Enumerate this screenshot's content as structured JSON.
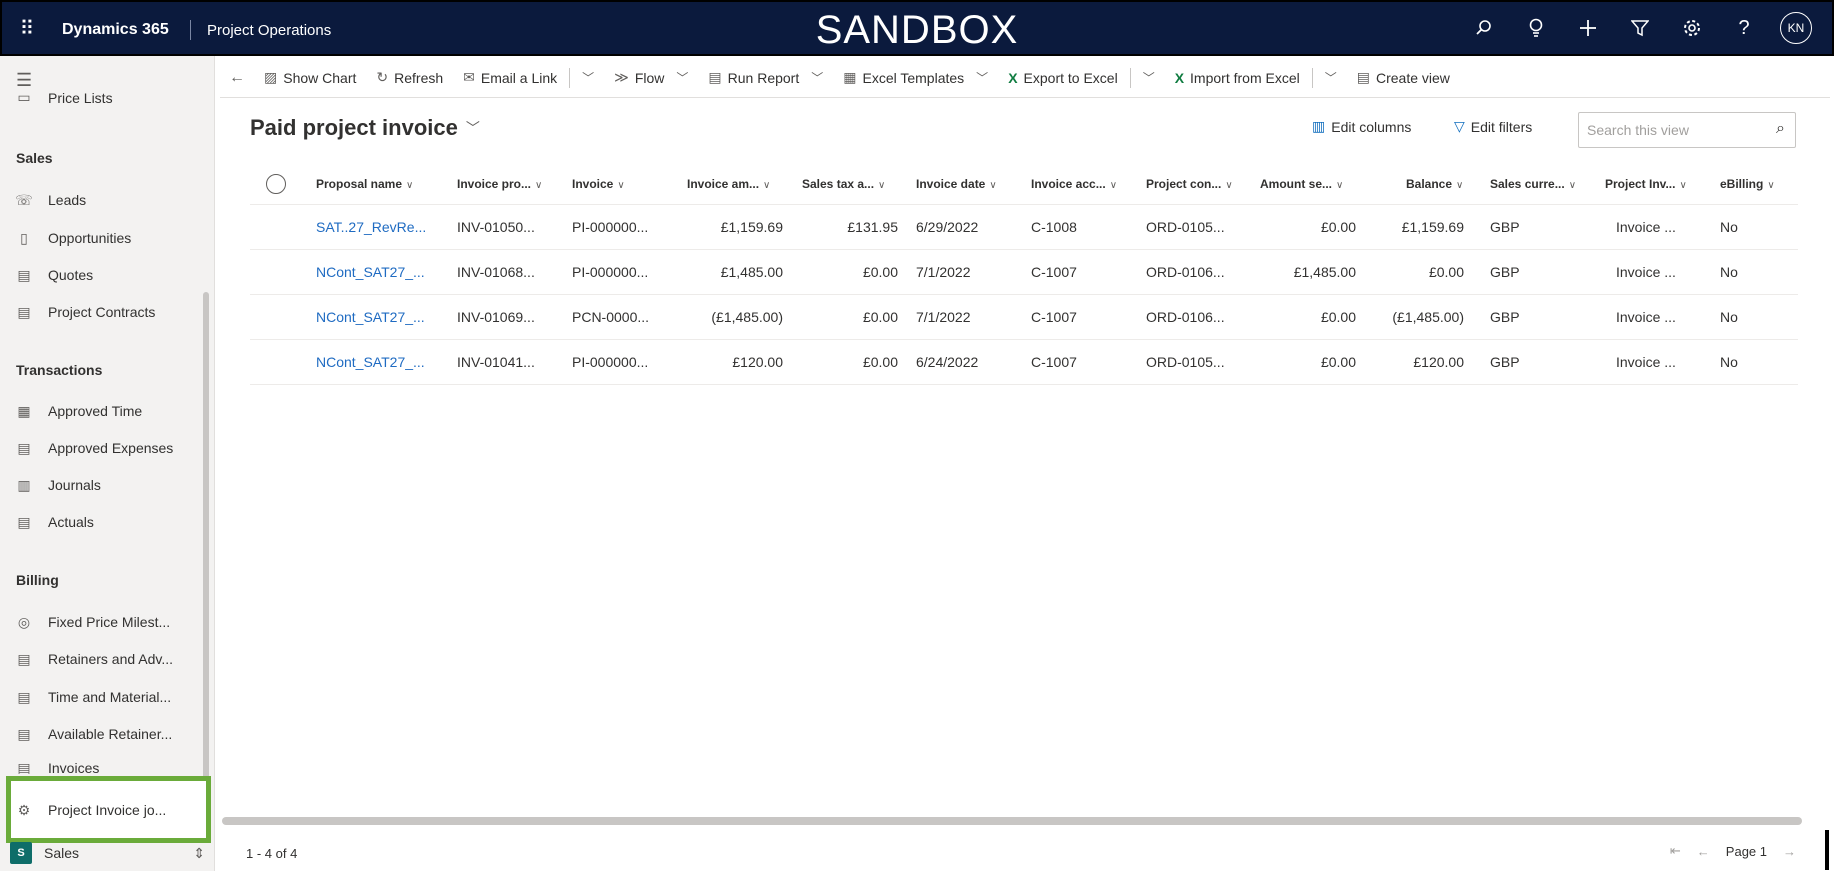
{
  "topbar": {
    "app_name": "Dynamics 365",
    "area_name": "Project Operations",
    "environment_banner": "SANDBOX",
    "user_initials": "KN"
  },
  "sidebar": {
    "partial_item": "Price Lists",
    "sections": [
      {
        "title": "Sales",
        "items": [
          "Leads",
          "Opportunities",
          "Quotes",
          "Project Contracts"
        ]
      },
      {
        "title": "Transactions",
        "items": [
          "Approved Time",
          "Approved Expenses",
          "Journals",
          "Actuals"
        ]
      },
      {
        "title": "Billing",
        "items": [
          "Fixed Price Milest...",
          "Retainers and Adv...",
          "Time and Material...",
          "Available Retainer...",
          "Invoices",
          "Project Invoice jo..."
        ]
      }
    ],
    "area_switcher": {
      "badge": "S",
      "label": "Sales"
    }
  },
  "commandbar": {
    "show_chart": "Show Chart",
    "refresh": "Refresh",
    "email_link": "Email a Link",
    "flow": "Flow",
    "run_report": "Run Report",
    "excel_templates": "Excel Templates",
    "export_excel": "Export to Excel",
    "import_excel": "Import from Excel",
    "create_view": "Create view"
  },
  "view": {
    "title": "Paid project invoice",
    "edit_columns": "Edit columns",
    "edit_filters": "Edit filters",
    "search_placeholder": "Search this view"
  },
  "grid": {
    "columns": [
      "Proposal name",
      "Invoice pro...",
      "Invoice",
      "Invoice am...",
      "Sales tax a...",
      "Invoice date",
      "Invoice acc...",
      "Project con...",
      "Amount se...",
      "Balance",
      "Sales curre...",
      "Project Inv...",
      "eBilling"
    ],
    "rows": [
      [
        "SAT..27_RevRe...",
        "INV-01050...",
        "PI-000000...",
        "£1,159.69",
        "£131.95",
        "6/29/2022",
        "C-1008",
        "ORD-0105...",
        "£0.00",
        "£1,159.69",
        "GBP",
        "Invoice ...",
        "No"
      ],
      [
        "NCont_SAT27_...",
        "INV-01068...",
        "PI-000000...",
        "£1,485.00",
        "£0.00",
        "7/1/2022",
        "C-1007",
        "ORD-0106...",
        "£1,485.00",
        "£0.00",
        "GBP",
        "Invoice ...",
        "No"
      ],
      [
        "NCont_SAT27_...",
        "INV-01069...",
        "PCN-0000...",
        "(£1,485.00)",
        "£0.00",
        "7/1/2022",
        "C-1007",
        "ORD-0106...",
        "£0.00",
        "(£1,485.00)",
        "GBP",
        "Invoice ...",
        "No"
      ],
      [
        "NCont_SAT27_...",
        "INV-01041...",
        "PI-000000...",
        "£120.00",
        "£0.00",
        "6/24/2022",
        "C-1007",
        "ORD-0105...",
        "£0.00",
        "£120.00",
        "GBP",
        "Invoice ...",
        "No"
      ]
    ]
  },
  "footer": {
    "count": "1 - 4 of 4",
    "page": "Page 1"
  },
  "colors": {
    "topbar_bg": "#0b1a3d",
    "link": "#1f6bc2",
    "highlight": "#6aab3a"
  }
}
